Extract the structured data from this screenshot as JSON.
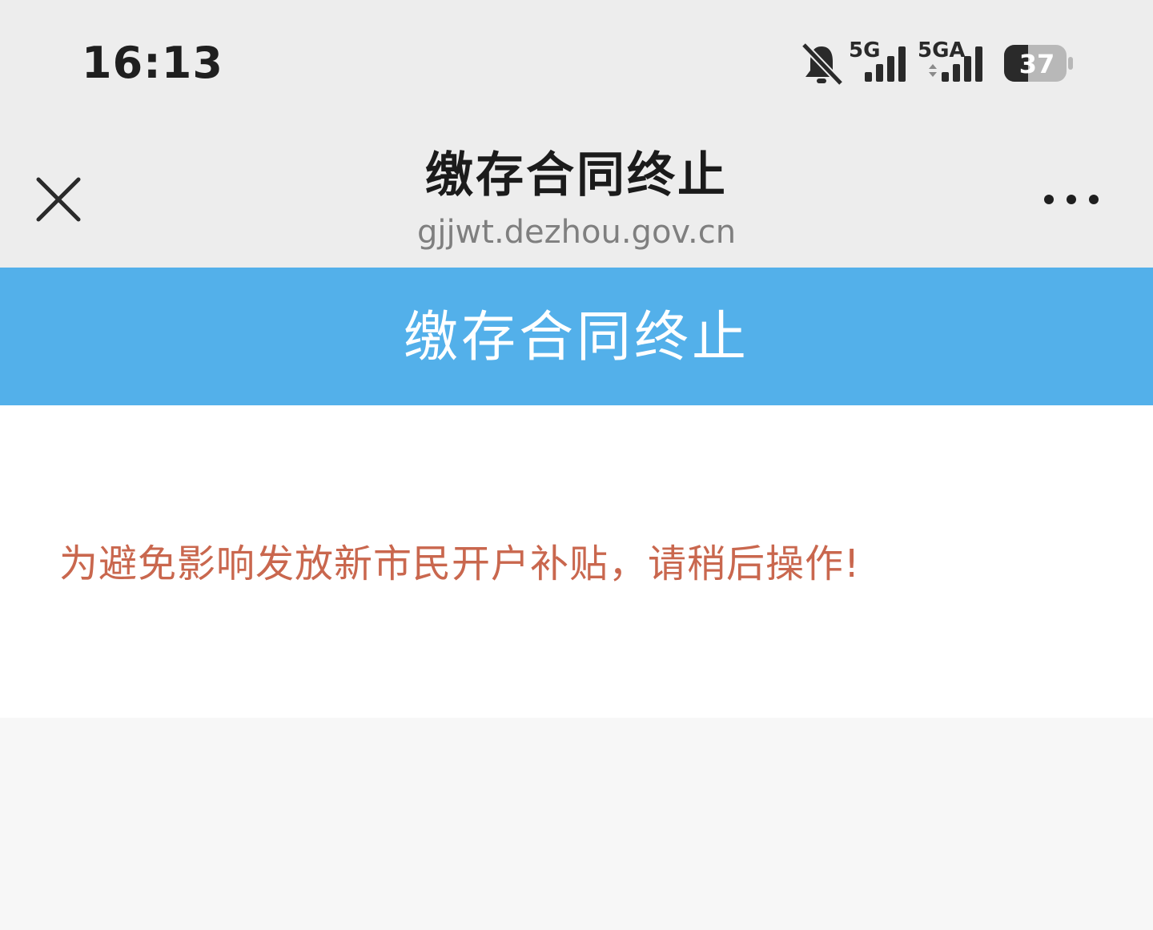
{
  "status_bar": {
    "time": "16:13",
    "network_1": "5G",
    "network_2": "5GA",
    "battery": "37"
  },
  "nav": {
    "title": "缴存合同终止",
    "url": "gjjwt.dezhou.gov.cn"
  },
  "page": {
    "header_title": "缴存合同终止",
    "notice": "为避免影响发放新市民开户补贴，请稍后操作!"
  },
  "colors": {
    "header_bg": "#53b0ea",
    "notice_text": "#c9674e",
    "chrome_bg": "#ededed"
  },
  "icons": {
    "close": "close-icon",
    "more": "more-icon",
    "mute": "bell-off-icon",
    "signal": "signal-icon",
    "battery": "battery-icon"
  }
}
